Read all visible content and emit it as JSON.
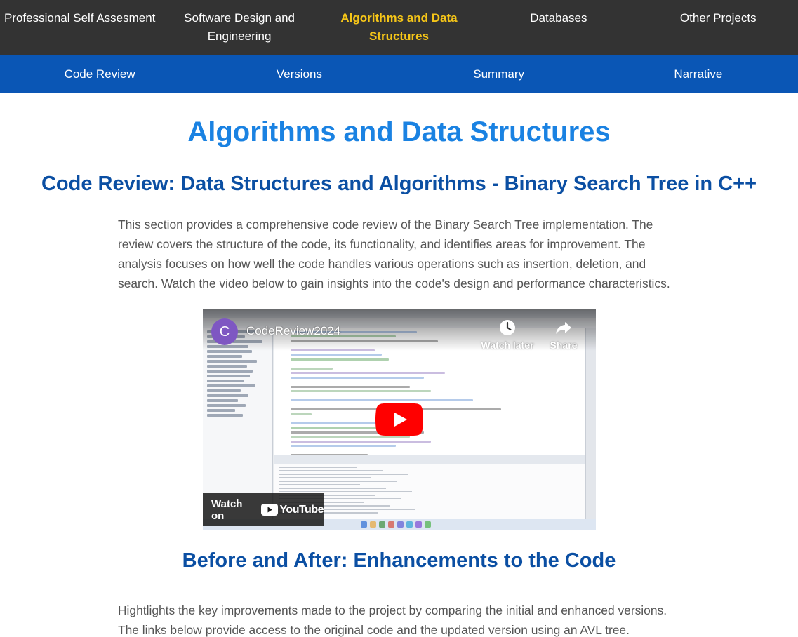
{
  "topnav": {
    "items": [
      {
        "label": "Professional Self Assesment"
      },
      {
        "label": "Software Design and Engineering"
      },
      {
        "label": "Algorithms and Data Structures",
        "active": true
      },
      {
        "label": "Databases"
      },
      {
        "label": "Other Projects"
      }
    ],
    "active_color": "#f5c518",
    "background": "#333333"
  },
  "subnav": {
    "items": [
      {
        "label": "Code Review"
      },
      {
        "label": "Versions"
      },
      {
        "label": "Summary"
      },
      {
        "label": "Narrative"
      }
    ],
    "background": "#0a56b5"
  },
  "main": {
    "title": "Algorithms and Data Structures",
    "code_review": {
      "heading": "Code Review: Data Structures and Algorithms - Binary Search Tree in C++",
      "paragraph": "This section provides a comprehensive code review of the Binary Search Tree implementation. The review covers the structure of the code, its functionality, and identifies areas for improvement. The analysis focuses on how well the code handles various operations such as insertion, deletion, and search. Watch the video below to gain insights into the code's design and performance characteristics."
    },
    "video": {
      "channel_initial": "C",
      "title": "CodeReview2024",
      "watch_later": "Watch later",
      "share": "Share",
      "watch_on": "Watch on",
      "youtube": "YouTube",
      "avatar_color": "#7e57c2",
      "play_color": "#ff0000"
    },
    "before_after": {
      "heading": "Before and After: Enhancements to the Code",
      "paragraph": "Hightlights the key improvements made to the project by comparing the initial and enhanced versions. The links below provide access to the original code and the updated version using an AVL tree."
    }
  }
}
